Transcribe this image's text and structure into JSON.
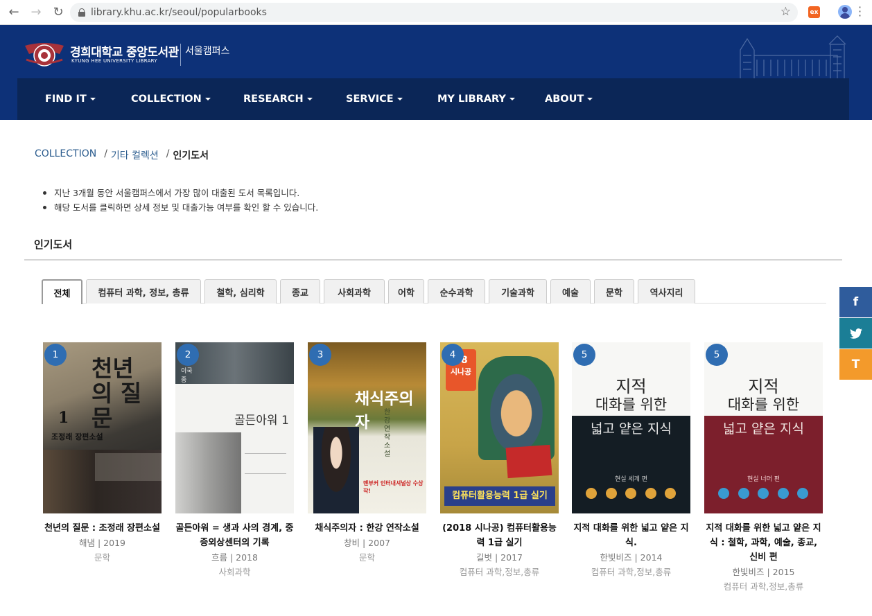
{
  "browser": {
    "url": "library.khu.ac.kr/seoul/popularbooks",
    "ext_label": "ex"
  },
  "header": {
    "title": "경희대학교 중앙도서관",
    "subtitle": "KYUNG HEE UNIVERSITY LIBRARY",
    "campus": "서울캠퍼스",
    "nav": [
      "FIND IT",
      "COLLECTION",
      "RESEARCH",
      "SERVICE",
      "MY LIBRARY",
      "ABOUT"
    ]
  },
  "breadcrumb": {
    "items": [
      "COLLECTION",
      "기타 컬렉션"
    ],
    "current": "인기도서"
  },
  "notes": [
    "지난 3개월 동안 서울캠퍼스에서 가장 많이 대출된 도서 목록입니다.",
    "해당 도서를 클릭하면 상세 정보 및 대출가능 여부를 확인 할 수 있습니다."
  ],
  "section_title": "인기도서",
  "tabs": [
    "전체",
    "컴퓨터 과학, 정보, 총류",
    "철학, 심리학",
    "종교",
    "사회과학",
    "어학",
    "순수과학",
    "기술과학",
    "예술",
    "문학",
    "역사지리"
  ],
  "social": {
    "facebook": "f",
    "twitter": "t",
    "other": "T"
  },
  "books": [
    {
      "rank": "1",
      "title": "천년의 질문 : 조정래 장편소설",
      "meta": "해냄 | 2019",
      "category": "문학",
      "cover": {
        "main": "천년의 질문",
        "num": "1",
        "author": "조정래 장편소설"
      }
    },
    {
      "rank": "2",
      "title": "골든아워 = 생과 사의 경계, 중증외상센터의 기록",
      "meta": "흐름 | 2018",
      "category": "사회과학",
      "cover": {
        "main": "골든아워 1",
        "author": "이국종"
      }
    },
    {
      "rank": "3",
      "title": "채식주의자 : 한강 연작소설",
      "meta": "창비 | 2007",
      "category": "문학",
      "cover": {
        "main": "채식주의자",
        "author": "한강 연작소설",
        "band": "맨부커 인터내셔널상 수상작!"
      }
    },
    {
      "rank": "4",
      "title": "(2018 시나공) 컴퓨터활용능력 1급 실기",
      "meta": "길벗 | 2017",
      "category": "컴퓨터 과학,정보,총류",
      "cover": {
        "main": "컴퓨터활용능력 1급 실기",
        "brand": "시나공",
        "year": "18"
      }
    },
    {
      "rank": "5",
      "title": "지적 대화를 위한 넓고 얕은 지식.",
      "meta": "한빛비즈 | 2014",
      "category": "컴퓨터 과학,정보,총류",
      "cover": {
        "line1": "지적",
        "line2": "대화를 위한",
        "line3": "넓고 얕은 지식",
        "tag": "현실 세계 편"
      }
    },
    {
      "rank": "5",
      "title": "지적 대화를 위한 넓고 얕은 지식 : 철학, 과학, 예술, 종교, 신비 편",
      "meta": "한빛비즈 | 2015",
      "category": "컴퓨터 과학,정보,총류",
      "cover": {
        "line1": "지적",
        "line2": "대화를 위한",
        "line3": "넓고 얕은 지식",
        "tag": "현실 너머 편"
      }
    }
  ]
}
